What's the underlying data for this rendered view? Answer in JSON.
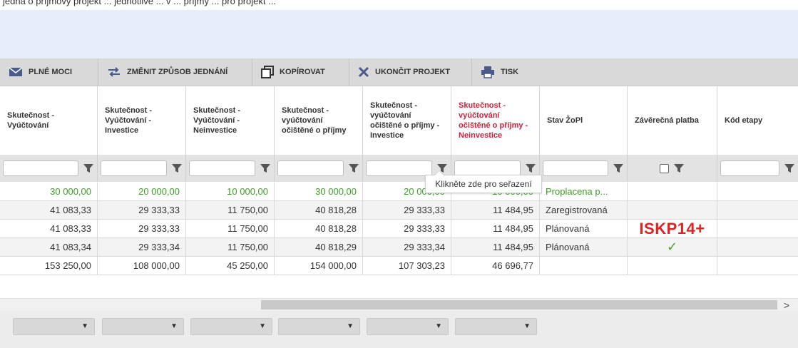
{
  "top_text": "jedná o příjmový projekt ... jednotlivé ... v ... příjmy ... pro projekt ... ",
  "toolbar": {
    "buttons": [
      {
        "label": "PLNÉ MOCI",
        "icon": "envelope-icon"
      },
      {
        "label": "ZMĚNIT ZPŮSOB JEDNÁNÍ",
        "icon": "swap-arrows-icon"
      },
      {
        "label": "KOPÍROVAT",
        "icon": "copy-icon"
      },
      {
        "label": "UKONČIT PROJEKT",
        "icon": "close-icon"
      },
      {
        "label": "TISK",
        "icon": "printer-icon"
      }
    ]
  },
  "columns": [
    {
      "label": "Skutečnost - Vyúčtování"
    },
    {
      "label": "Skutečnost - Vyúčtování - Investice"
    },
    {
      "label": "Skutečnost - Vyúčtování - Neinvestice"
    },
    {
      "label": "Skutečnost - vyúčtování očištěné o příjmy"
    },
    {
      "label": "Skutečnost - vyúčtování očištěné o příjmy - Investice"
    },
    {
      "label": "Skutečnost - vyúčtování očištěné o příjmy - Neinvestice"
    },
    {
      "label": "Stav ŽoPl"
    },
    {
      "label": "Závěrečná platba"
    },
    {
      "label": "Kód etapy"
    }
  ],
  "tooltip": "Klikněte zde pro seřazení",
  "rows": [
    {
      "cells": [
        "30 000,00",
        "20 000,00",
        "10 000,00",
        "30 000,00",
        "20 000,00",
        "10 000,00",
        "Proplacena p...",
        "",
        ""
      ],
      "green": true
    },
    {
      "cells": [
        "41 083,33",
        "29 333,33",
        "11 750,00",
        "40 818,28",
        "29 333,33",
        "11 484,95",
        "Zaregistrovaná",
        "",
        ""
      ]
    },
    {
      "cells": [
        "41 083,33",
        "29 333,33",
        "11 750,00",
        "40 818,28",
        "29 333,33",
        "11 484,95",
        "Plánovaná",
        "ISKP14+",
        ""
      ]
    },
    {
      "cells": [
        "41 083,34",
        "29 333,34",
        "11 750,00",
        "40 818,29",
        "29 333,34",
        "11 484,95",
        "Plánovaná",
        "✓",
        ""
      ]
    },
    {
      "cells": [
        "153 250,00",
        "108 000,00",
        "45 250,00",
        "154 000,00",
        "107 303,23",
        "46 696,77",
        "",
        "",
        ""
      ]
    }
  ],
  "colors": {
    "accent_red": "#d1203a",
    "green_text": "#3e9c28",
    "iskp_red": "#e02222"
  },
  "scroll": {
    "right_arrow": ">"
  }
}
